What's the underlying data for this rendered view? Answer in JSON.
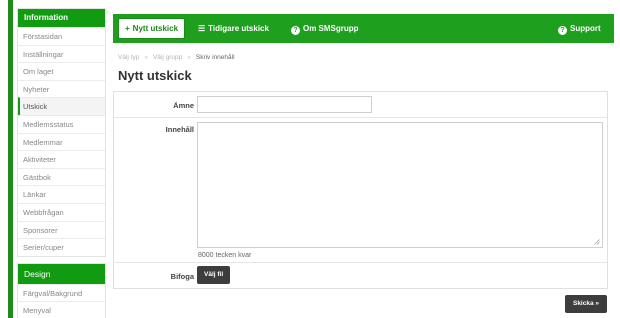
{
  "sidebar": {
    "info_header": "Information",
    "info_items": [
      "Förstasidan",
      "Inställningar",
      "Om laget",
      "Nyheter",
      "Utskick",
      "Medlemsstatus",
      "Medlemmar",
      "Aktiviteter",
      "Gästbok",
      "Länkar",
      "Webbfrågan",
      "Sponsorer",
      "Serier/cuper"
    ],
    "active_item": "Utskick",
    "design_header": "Design",
    "design_items": [
      "Färgval/Bakgrund",
      "Menyval"
    ]
  },
  "topnav": {
    "new_label": "Nytt utskick",
    "new_icon": "plus-icon",
    "previous_label": "Tidigare utskick",
    "previous_icon": "list-icon",
    "about_label": "Om SMSgrupp",
    "about_icon": "question-circle-icon",
    "support_label": "Support",
    "support_icon": "question-circle-icon"
  },
  "breadcrumb": {
    "step1": "Välj typ",
    "step2": "Välj grupp",
    "step3": "Skriv innehåll",
    "separator": "»"
  },
  "page": {
    "title": "Nytt utskick"
  },
  "form": {
    "subject_label": "Ämne",
    "subject_value": "",
    "content_label": "Innehåll",
    "content_value": "",
    "counter_text": "8000 tecken kvar",
    "attach_label": "Bifoga",
    "choose_file_label": "Välj fil"
  },
  "actions": {
    "send_label": "Skicka »"
  },
  "colors": {
    "brand_green": "#1ea01e",
    "header_green": "#109b10",
    "dark_button": "#3d3d3d"
  }
}
